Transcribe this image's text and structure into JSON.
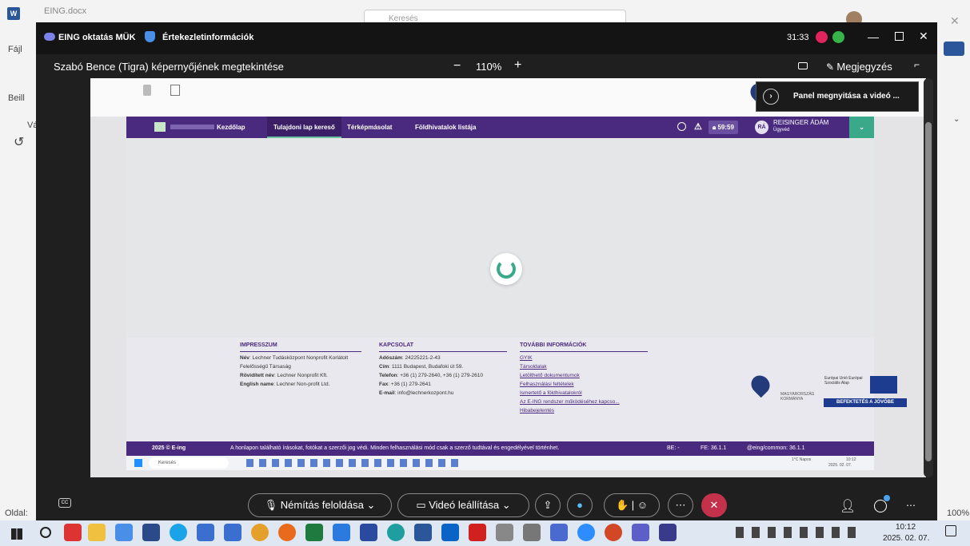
{
  "word": {
    "doc_title": "EING.docx",
    "search_placeholder": "Keresés",
    "file_tab": "Fájl",
    "paste_label": "Beill",
    "clip_label": "Vá",
    "page_status": "Oldal:",
    "zoom": "100%"
  },
  "teams": {
    "meeting_name": "EING oktatás MÜK",
    "meeting_info": "Értekezletinformációk",
    "timer": "31:33",
    "share_title": "Szabó Bence (Tigra) képernyőjének megtekintése",
    "zoom_minus": "−",
    "zoom_level": "110%",
    "zoom_plus": "+",
    "notes_label": "Megjegyzés",
    "popup_text": "Panel megnyitása a videó ...",
    "unmute_label": "Némítás feloldása",
    "video_label": "Videó leállítása",
    "cc_label": "CC"
  },
  "site": {
    "nav": [
      "Kezdőlap",
      "Tulajdoni lap kereső",
      "Térképmásolat",
      "Földhivatalok listája"
    ],
    "session_timer": "59:59",
    "user_initials": "RÁ",
    "user_name": "REISINGER ÁDÁM",
    "user_role": "Ügyvéd",
    "footer": {
      "impresszum_title": "IMPRESSZUM",
      "impresszum": [
        {
          "k": "Név",
          "v": ": Lechner Tudásközpont Nonprofit Korlátolt Felelősségű Társaság"
        },
        {
          "k": "Rövidített név",
          "v": ": Lechner Nonprofit Kft."
        },
        {
          "k": "English name",
          "v": ": Lechner Non-profit Ltd."
        }
      ],
      "kapcsolat_title": "KAPCSOLAT",
      "kapcsolat": [
        {
          "k": "Adószám",
          "v": ": 24225221-2-43"
        },
        {
          "k": "Cím",
          "v": ": 1111 Budapest, Budafoki út 59."
        },
        {
          "k": "Telefon",
          "v": ": +36 (1) 279-2640, +36 (1) 279-2610"
        },
        {
          "k": "Fax",
          "v": ": +36 (1) 279-2641"
        },
        {
          "k": "E-mail",
          "v": ": info@lechnerkozpont.hu"
        }
      ],
      "tovabbi_title": "TOVÁBBI INFORMÁCIÓK",
      "tovabbi": [
        "GYIK",
        "Társoldalak",
        "Letölthető dokumentumok",
        "Felhasználási feltételek",
        "Ismertető a földhivatalokról",
        "Az E-ING rendszer működéséhez kapcso...",
        "Hibabejelentés"
      ],
      "eu_text": "BEFEKTETÉS A JÖVŐBE",
      "eu_fund": "Európai Unió Európai Szociális Alap",
      "hu_gov": "MAGYARORSZÁG KORMÁNYA",
      "copyright": "2025 © E-ing",
      "notice": "A honlapon található írásokat, fotókat a szerzői jog védi. Minden felhasználási mód csak a szerző tudtával és engedélyével történhet.",
      "be": "BE: -",
      "fe": "FE: 36.1.1",
      "common": "@eing/common: 36.1.1"
    },
    "inner_search": "Keresés",
    "inner_weather": "1°C Napos",
    "inner_time": "10:12",
    "inner_date": "2025. 02. 07."
  },
  "taskbar": {
    "time": "10:12",
    "date": "2025. 02. 07."
  },
  "colors": {
    "brand_purple": "#4a2a7e",
    "teams_bg": "#1f1f1f",
    "hangup": "#c4314b",
    "spinner": "#3aa98a"
  }
}
